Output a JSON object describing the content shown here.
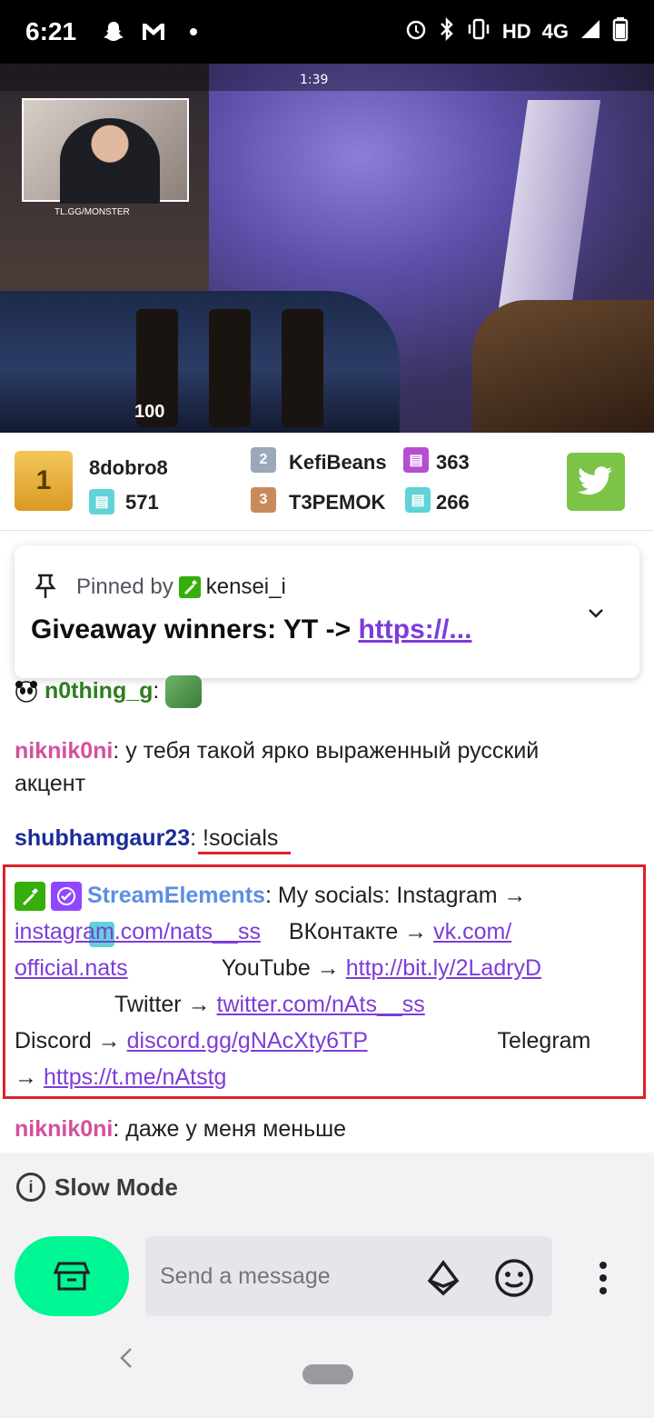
{
  "status_bar": {
    "time": "6:21",
    "network": "HD",
    "signal": "4G"
  },
  "video": {
    "round_clock": "1:39",
    "health": "100",
    "sponsor_tag": "TL.GG/MONSTER"
  },
  "leaderboard": {
    "first": {
      "rank": "1",
      "name": "8dobro8",
      "count": "571"
    },
    "second": {
      "rank": "2",
      "name": "KefiBeans",
      "count": "363"
    },
    "third": {
      "rank": "3",
      "name": "T3PEMOK",
      "count": "266"
    }
  },
  "pinned": {
    "label": "Pinned by",
    "pinner": "kensei_i",
    "message_prefix": "Giveaway winners: YT -> ",
    "message_link": "https://..."
  },
  "chat": {
    "msg1": {
      "user": "n0thing_g",
      "sep": ":"
    },
    "msg2": {
      "user": "niknik0ni",
      "sep": ":",
      "text": " у тебя такой ярко выраженный русский",
      "text2": "акцент"
    },
    "msg3": {
      "user": "shubhamgaur23",
      "sep": ":",
      "text": " !socials"
    },
    "msg4": {
      "user": "StreamElements",
      "sep": ":",
      "intro": " My socials: Instagram →",
      "ig_link": "instagram.com/nats__ss",
      "vk_label": "ВКонтакте →",
      "vk_link": "vk.com/",
      "vk_link2": "official.nats",
      "yt_label": "YouTube →",
      "yt_link": "http://bit.ly/2LadryD",
      "tw_label": "Twitter →",
      "tw_link": "twitter.com/nAts__ss",
      "dc_label": "Discord →",
      "dc_link": "discord.gg/gNAcXty6TP",
      "tg_label": "Telegram",
      "tg_arrow": "→",
      "tg_link": "https://t.me/nAtstg"
    },
    "msg5": {
      "user": "niknik0ni",
      "sep": ":",
      "text": " даже у меня меньше"
    }
  },
  "slow_mode": {
    "label": "Slow Mode"
  },
  "input": {
    "placeholder": "Send a message"
  },
  "colors": {
    "accent": "#9146ff",
    "store": "#00f593",
    "highlight": "#e0202a",
    "link": "#7d3cd8"
  },
  "icons": [
    "snapchat-icon",
    "gmail-icon",
    "alarm-icon",
    "bluetooth-icon",
    "vibrate-icon",
    "signal-icon",
    "battery-icon",
    "pin-icon",
    "chevron-down-icon",
    "twitter-icon",
    "info-icon",
    "store-icon",
    "bits-icon",
    "emote-icon",
    "more-icon",
    "back-icon"
  ]
}
